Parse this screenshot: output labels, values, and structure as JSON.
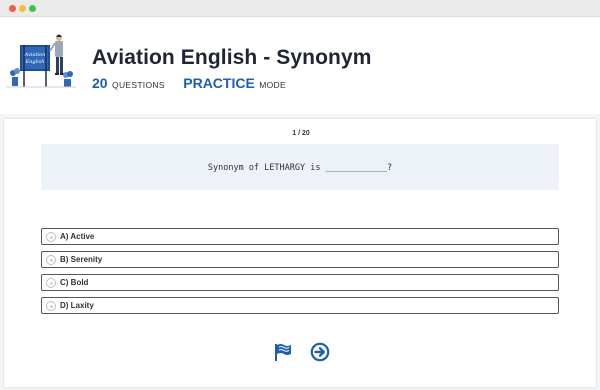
{
  "window": {
    "controls": [
      "close",
      "minimize",
      "maximize"
    ]
  },
  "quiz": {
    "title": "Aviation English - Synonym",
    "question_count": "20",
    "questions_label": "QUESTIONS",
    "mode_name": "PRACTICE",
    "mode_label": "MODE",
    "thumbnail_text_line1": "Aviation",
    "thumbnail_text_line2": "English"
  },
  "question": {
    "progress": "1 / 20",
    "text": "Synonym of LETHARGY is ____________?"
  },
  "options": [
    {
      "label": "A) Active"
    },
    {
      "label": "B) Serenity"
    },
    {
      "label": "C) Bold"
    },
    {
      "label": "D) Laxity"
    }
  ],
  "actions": {
    "flag_icon": "flag-icon",
    "next_icon": "arrow-right-circle-icon"
  },
  "colors": {
    "accent": "#1b5fb4",
    "question_background": "#edf1f8",
    "panel_background": "#f3f4f6"
  }
}
